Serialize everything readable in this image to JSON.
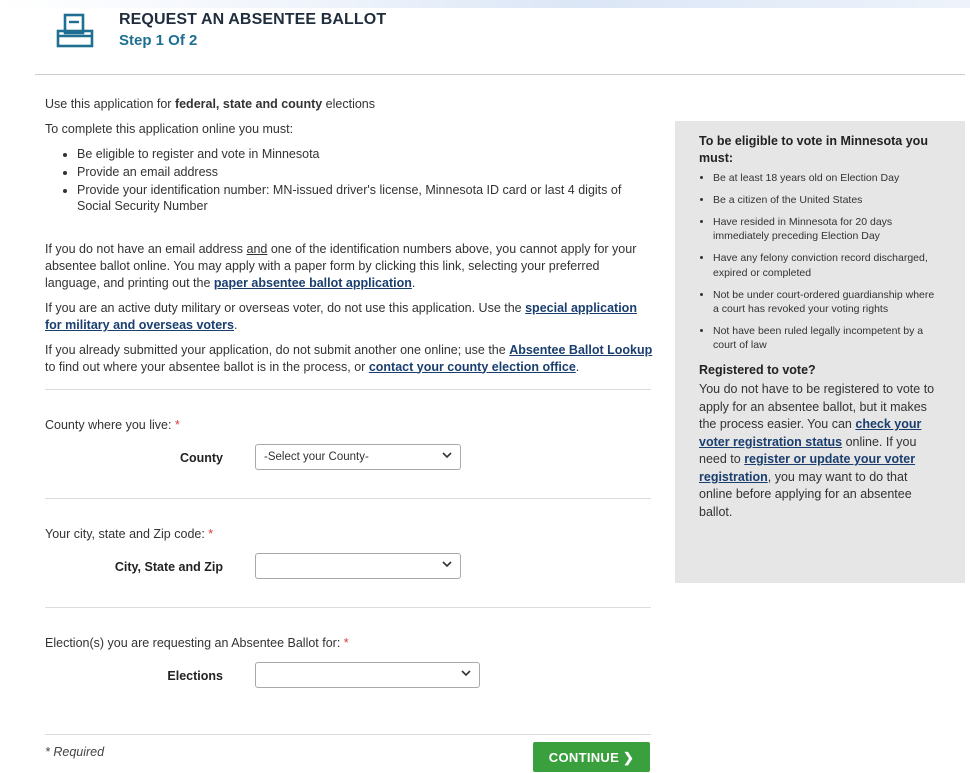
{
  "header": {
    "title": "REQUEST AN ABSENTEE BALLOT",
    "step": "Step 1 Of 2",
    "icon": "ballot-box-icon"
  },
  "intro": {
    "line1_prefix": "Use this application for ",
    "line1_bold": "federal, state and county",
    "line1_suffix": " elections",
    "line2": "To complete this application online you must:",
    "requirements": [
      "Be eligible to register and vote in Minnesota",
      "Provide an email address",
      "Provide your identification number: MN-issued driver's license, Minnesota ID card or last 4 digits of Social Security Number"
    ]
  },
  "para1": {
    "a": "If you do not have an email address ",
    "and": "and",
    "b": " one of the identification numbers above, you cannot apply for your absentee ballot online. You may apply with a paper form by clicking this link, selecting your preferred language, and printing out the ",
    "link": "paper absentee ballot application",
    "c": "."
  },
  "para2": {
    "a": "If you are an active duty military or overseas voter, do not use this application. Use the ",
    "link": "special application for military and overseas voters",
    "b": "."
  },
  "para3": {
    "a": "If you already submitted your application, do not submit another one online; use the ",
    "link1": "Absentee Ballot Lookup",
    "b": " to find out where your absentee ballot is in the process, or ",
    "link2": "contact your county election office",
    "c": "."
  },
  "form": {
    "county": {
      "question": "County where you live: ",
      "label": "County",
      "value": "-Select your County-"
    },
    "city": {
      "question": "Your city, state and Zip code: ",
      "label": "City, State and Zip",
      "value": ""
    },
    "elections": {
      "question": "Election(s) you are requesting an Absentee Ballot for: ",
      "label": "Elections",
      "value": ""
    },
    "required_marker": "*",
    "required_note": "* Required",
    "continue_label": "CONTINUE ❯"
  },
  "sidebar": {
    "eligibility_title": "To be eligible to vote in Minnesota you must:",
    "eligibility_items": [
      "Be at least 18 years old on Election Day",
      "Be a citizen of the United States",
      "Have resided in Minnesota for 20 days immediately preceding Election Day",
      "Have any felony conviction record discharged, expired or completed",
      "Not be under court-ordered guardianship where a court has revoked your voting rights",
      "Not have been ruled legally incompetent by a court of law"
    ],
    "reg_title": "Registered to vote?",
    "reg_a": "You do not have to be registered to vote to apply for an absentee ballot, but it makes the process easier. You can ",
    "reg_link1": "check your voter registration status",
    "reg_b": " online. If you need to ",
    "reg_link2": "register or update your voter registration",
    "reg_c": ", you may want to do that online before applying for an absentee ballot."
  },
  "colors": {
    "accent": "#1f6f92",
    "link": "#1a3e6e",
    "button": "#3aa03d",
    "required": "#d93b3b",
    "sidebar_bg": "#e6e6e6"
  }
}
